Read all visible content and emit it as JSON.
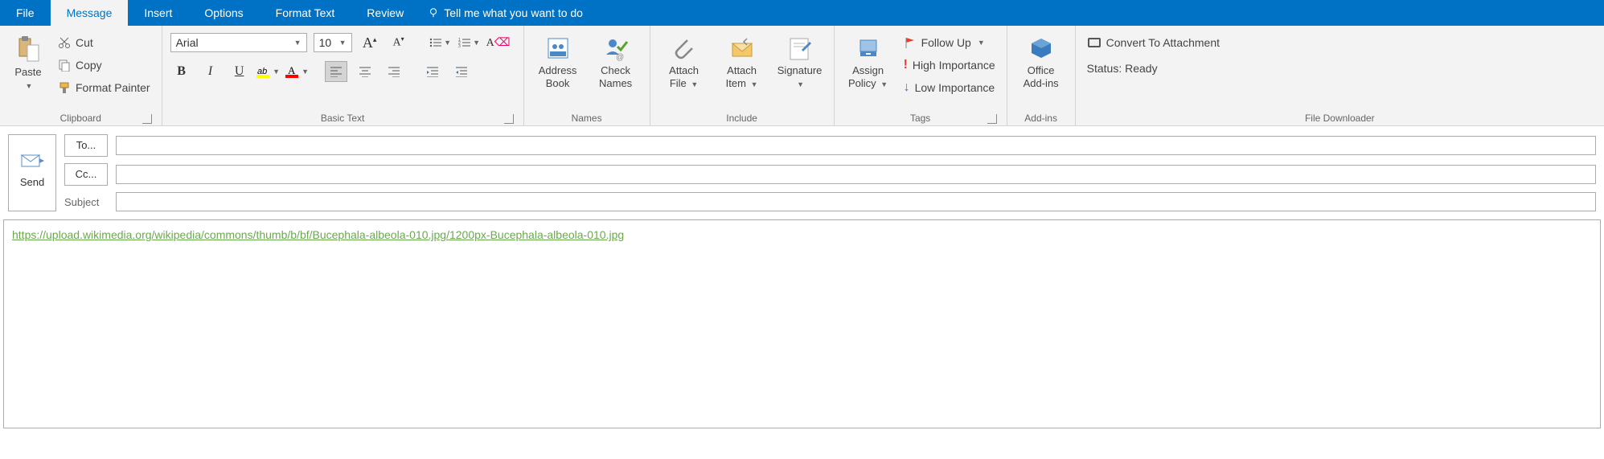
{
  "tabs": {
    "file": "File",
    "message": "Message",
    "insert": "Insert",
    "options": "Options",
    "formattext": "Format Text",
    "review": "Review",
    "tellme": "Tell me what you want to do"
  },
  "clipboard": {
    "paste": "Paste",
    "cut": "Cut",
    "copy": "Copy",
    "painter": "Format Painter",
    "group": "Clipboard"
  },
  "basictext": {
    "font": "Arial",
    "size": "10",
    "group": "Basic Text"
  },
  "names": {
    "addressbook": "Address\nBook",
    "checknames": "Check\nNames",
    "group": "Names"
  },
  "include": {
    "attachfile": "Attach\nFile",
    "attachitem": "Attach\nItem",
    "signature": "Signature",
    "group": "Include"
  },
  "tags": {
    "assignpolicy": "Assign\nPolicy",
    "followup": "Follow Up",
    "high": "High Importance",
    "low": "Low Importance",
    "group": "Tags"
  },
  "addins": {
    "office": "Office\nAdd-ins",
    "group": "Add-ins"
  },
  "downloader": {
    "convert": "Convert To Attachment",
    "status": "Status: Ready",
    "group": "File Downloader"
  },
  "compose": {
    "send": "Send",
    "to": "To...",
    "cc": "Cc...",
    "subject": "Subject",
    "body_link": "https://upload.wikimedia.org/wikipedia/commons/thumb/b/bf/Bucephala-albeola-010.jpg/1200px-Bucephala-albeola-010.jpg"
  }
}
